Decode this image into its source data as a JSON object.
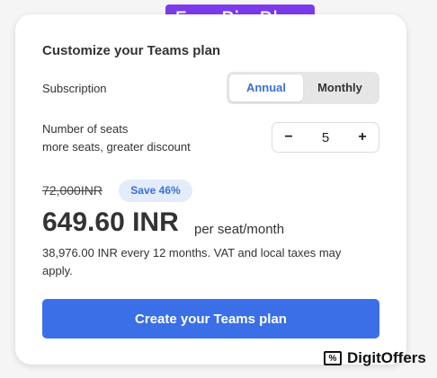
{
  "brand_badge": "FreePic Plan",
  "title": "Customize your Teams plan",
  "subscription": {
    "label": "Subscription",
    "options": [
      {
        "label": "Annual",
        "selected": true
      },
      {
        "label": "Monthly",
        "selected": false
      }
    ]
  },
  "seats": {
    "label_line1": "Number of seats",
    "label_line2": "more seats, greater discount",
    "decrement": "−",
    "value": "5",
    "increment": "+"
  },
  "pricing": {
    "old_price": "72,000INR",
    "save_badge": "Save 46%",
    "price": "649.60 INR",
    "per_seat": "per seat/month",
    "note": "38,976.00 INR every 12 months. VAT and local taxes may apply."
  },
  "cta_label": "Create your Teams plan",
  "watermark": {
    "icon": "percent-icon",
    "text": "DigitOffers"
  },
  "colors": {
    "accent": "#3b6fe8",
    "badge_purple": "#7c3aed",
    "save_badge_bg": "#e3ecfb"
  }
}
